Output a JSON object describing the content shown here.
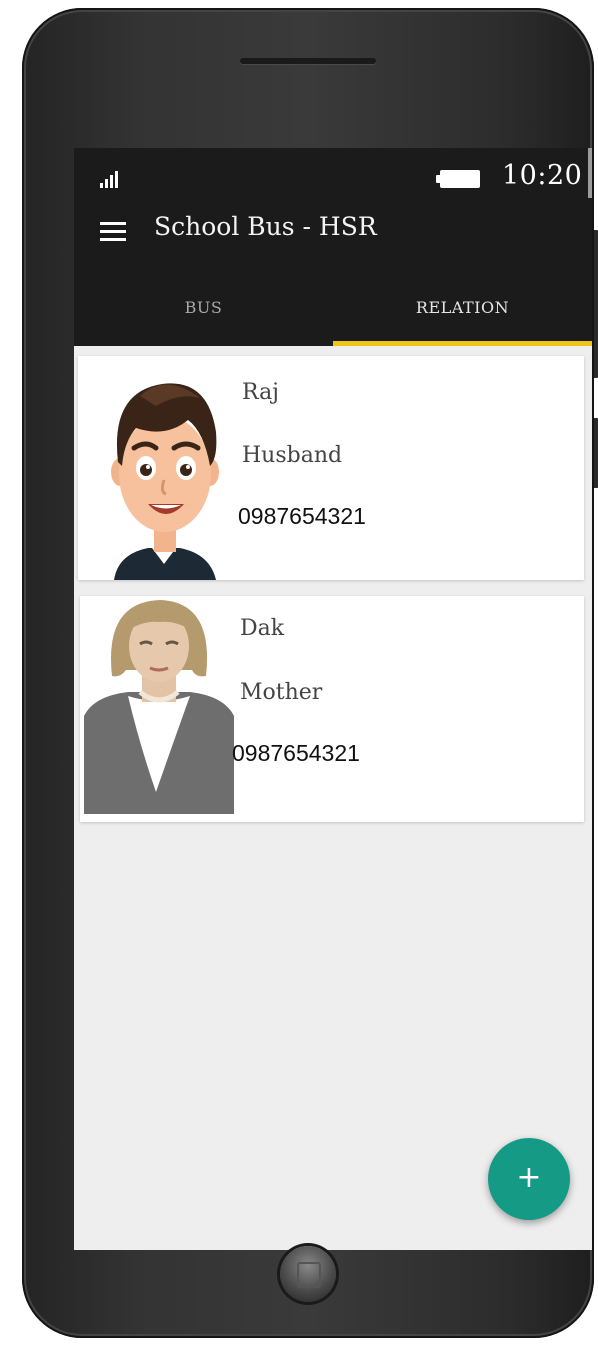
{
  "status_bar": {
    "time": "10:20",
    "signal_icon": "signal-icon",
    "battery_icon": "battery-icon"
  },
  "app_bar": {
    "menu_icon": "hamburger-menu-icon",
    "title": "School Bus - HSR"
  },
  "tabs": [
    {
      "label": "BUS",
      "selected": false
    },
    {
      "label": "RELATION",
      "selected": true
    }
  ],
  "colors": {
    "app_bar_bg": "#1b1b1b",
    "tab_indicator": "#f0c419",
    "fab_bg": "#159a86",
    "screen_bg": "#eeeeee"
  },
  "relations": [
    {
      "name": "Raj",
      "relation": "Husband",
      "phone": "0987654321",
      "avatar": "man-avatar"
    },
    {
      "name": "Dak",
      "relation": "Mother",
      "phone": "0987654321",
      "avatar": "woman-avatar"
    }
  ],
  "fab": {
    "label": "+",
    "icon": "add-icon"
  }
}
